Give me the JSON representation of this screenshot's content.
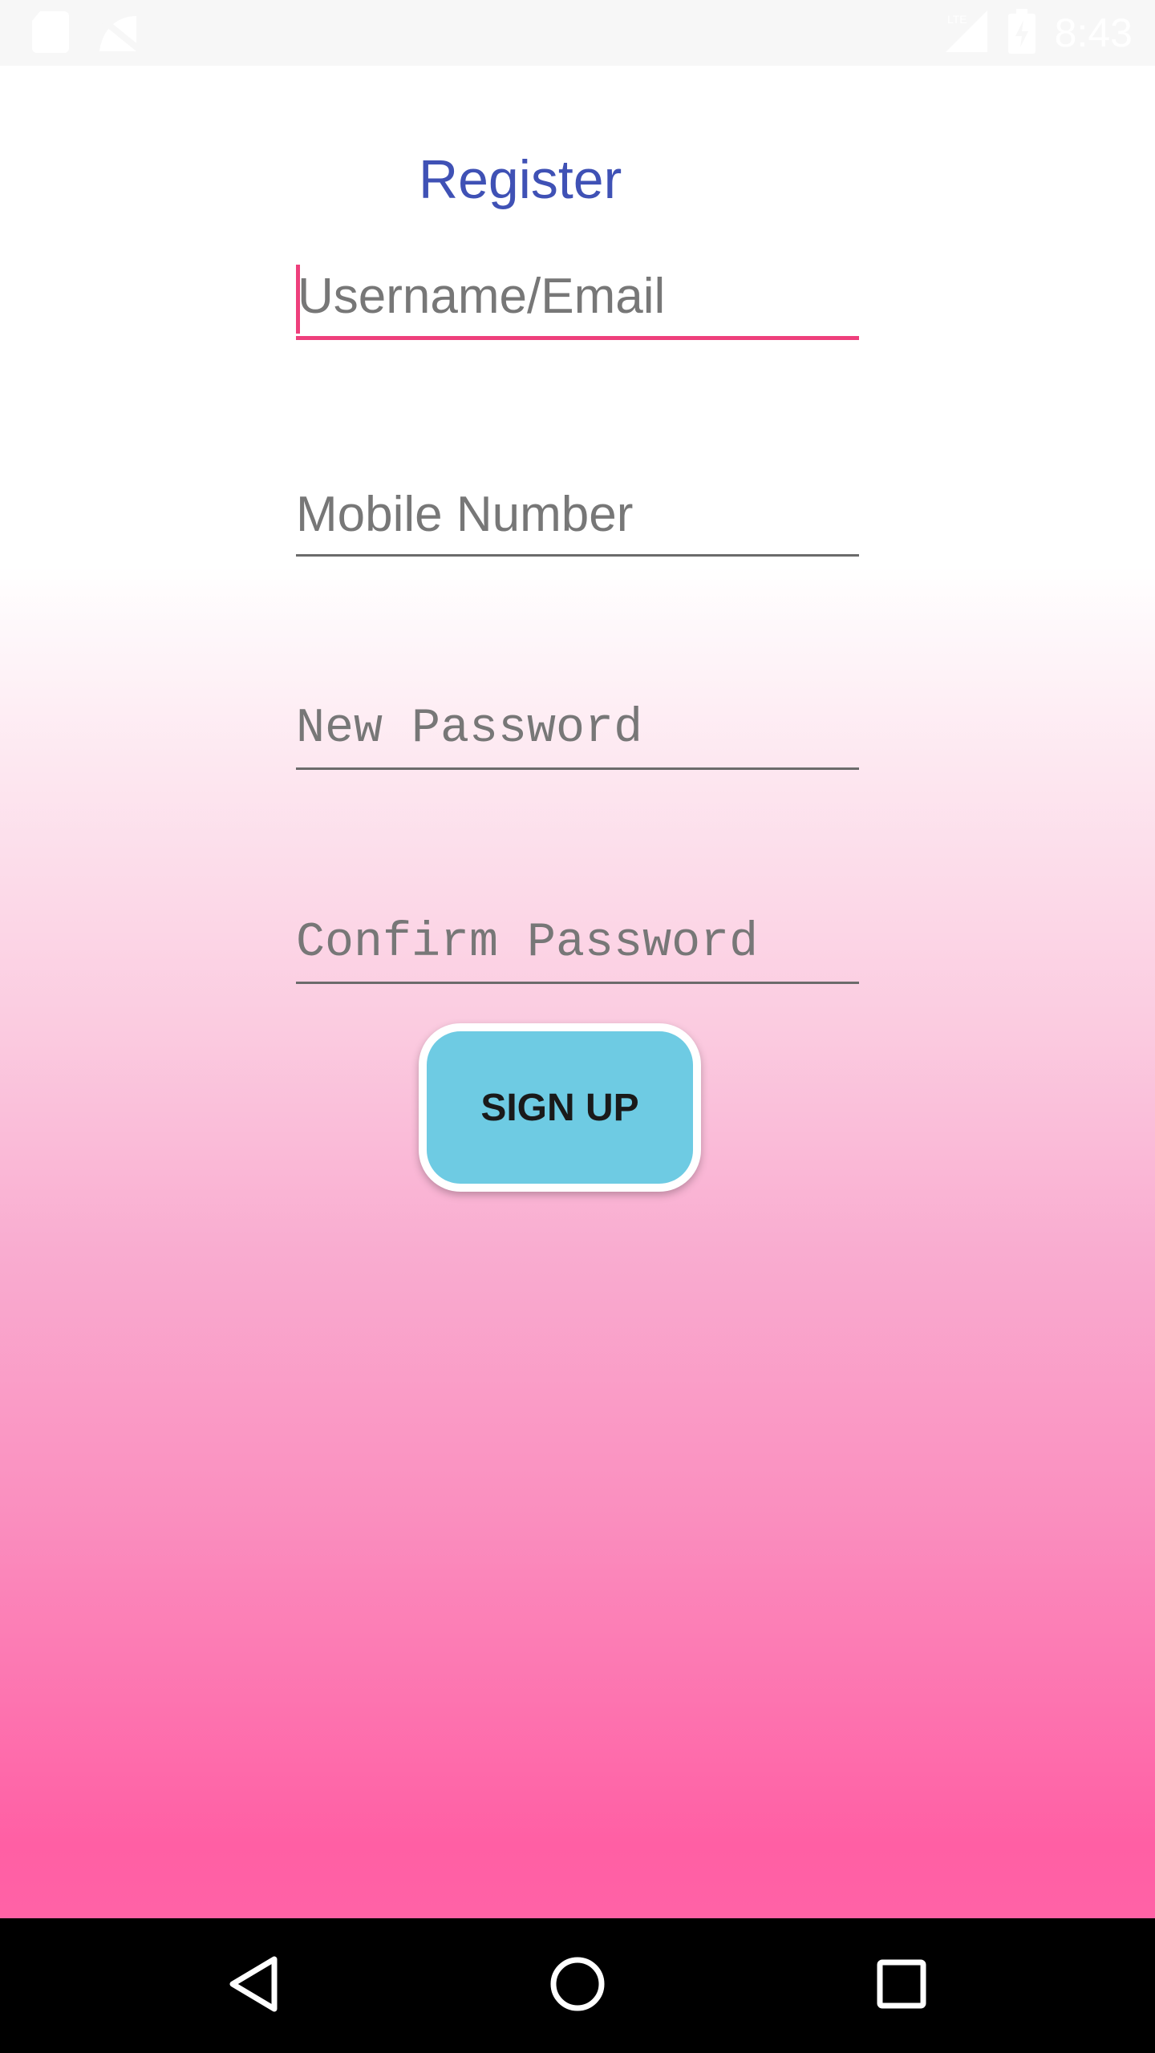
{
  "status_bar": {
    "time": "8:43",
    "icons": [
      "sd-card-icon",
      "no-signal-icon",
      "lte-signal-icon",
      "battery-charging-icon"
    ]
  },
  "register": {
    "title": "Register",
    "username_placeholder": "Username/Email",
    "mobile_placeholder": "Mobile Number",
    "new_password_placeholder": "New Password",
    "confirm_password_placeholder": "Confirm Password",
    "signup_label": "SIGN UP"
  },
  "colors": {
    "title": "#3f51b5",
    "focus_accent": "#ee3f7c",
    "button": "#6ecbe3",
    "gradient_bottom": "#ff62a6"
  },
  "nav_bar": {
    "icons": [
      "back-icon",
      "home-icon",
      "recents-icon"
    ]
  }
}
